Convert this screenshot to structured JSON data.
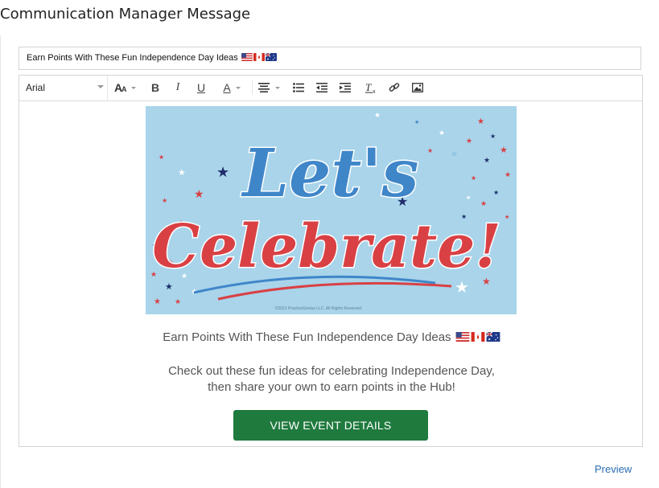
{
  "page": {
    "title": "Communication Manager Message"
  },
  "subject": {
    "text": "Earn Points With These Fun Independence Day Ideas",
    "flags": [
      "us-flag-icon",
      "canada-flag-icon",
      "australia-flag-icon"
    ]
  },
  "toolbar": {
    "font": "Arial",
    "tools": [
      "font-size-icon",
      "bold-icon",
      "italic-icon",
      "underline-icon",
      "text-color-icon",
      "align-icon",
      "bullet-list-icon",
      "outdent-icon",
      "indent-icon",
      "clear-format-icon",
      "link-icon",
      "image-icon"
    ]
  },
  "banner": {
    "line1": "Let's",
    "line2": "Celebrate!",
    "copyright": "©2021 PracticeGenius LLC. All Rights Reserved.",
    "colors": {
      "background": "#a9d4ea",
      "red": "#d94044",
      "navy": "#1f2f6b",
      "blue": "#3f86c9",
      "white": "#ffffff"
    }
  },
  "message": {
    "heading": "Earn Points With These Fun Independence Day Ideas",
    "body_line1": "Check out these fun ideas for celebrating Independence Day,",
    "body_line2": "then share your own to earn points in the Hub!",
    "cta_label": "VIEW EVENT DETAILS",
    "cta_color": "#1f7a3e"
  },
  "footer": {
    "preview_label": "Preview"
  }
}
